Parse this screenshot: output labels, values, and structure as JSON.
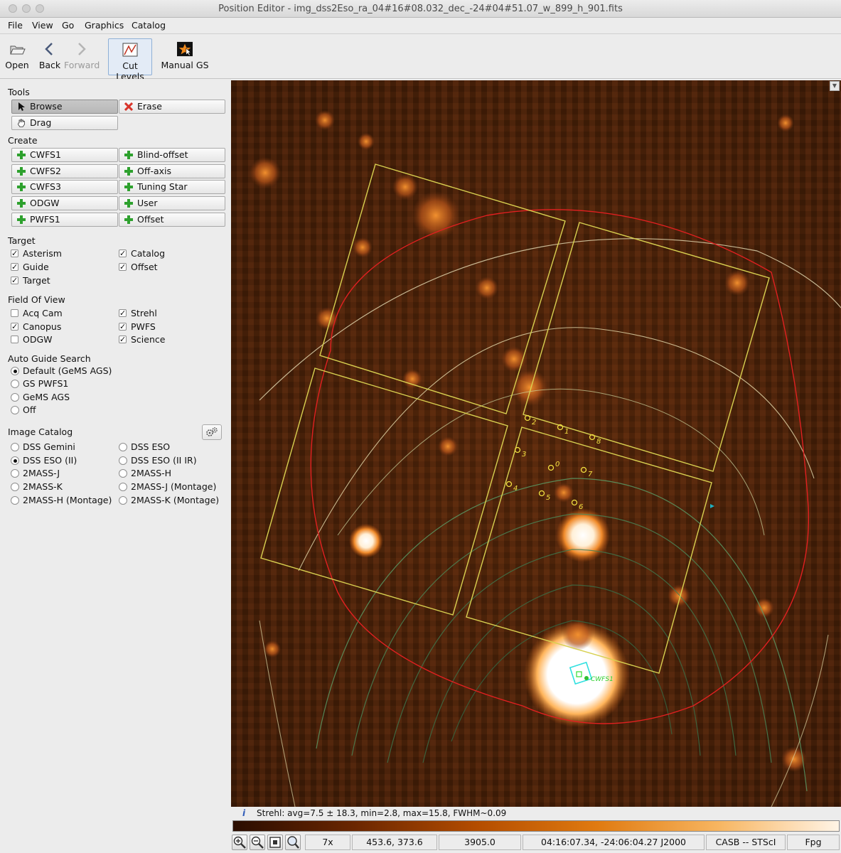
{
  "window": {
    "title": "Position Editor - img_dss2Eso_ra_04#16#08.032_dec_-24#04#51.07_w_899_h_901.fits"
  },
  "menu": [
    "File",
    "View",
    "Go",
    "Graphics",
    "Catalog"
  ],
  "toolbar": {
    "open": "Open",
    "back": "Back",
    "forward": "Forward",
    "cut_levels": "Cut Levels",
    "manual_gs": "Manual GS"
  },
  "tools": {
    "heading": "Tools",
    "browse": "Browse",
    "erase": "Erase",
    "drag": "Drag"
  },
  "create": {
    "heading": "Create",
    "left": [
      "CWFS1",
      "CWFS2",
      "CWFS3",
      "ODGW",
      "PWFS1"
    ],
    "right": [
      "Blind-offset",
      "Off-axis",
      "Tuning Star",
      "User",
      "Offset"
    ]
  },
  "target": {
    "heading": "Target",
    "items": [
      {
        "label": "Asterism",
        "checked": true
      },
      {
        "label": "Catalog",
        "checked": true
      },
      {
        "label": "Guide",
        "checked": true
      },
      {
        "label": "Offset",
        "checked": true
      },
      {
        "label": "Target",
        "checked": true
      }
    ]
  },
  "fov": {
    "heading": "Field Of View",
    "items": [
      {
        "label": "Acq Cam",
        "checked": false
      },
      {
        "label": "Strehl",
        "checked": true
      },
      {
        "label": "Canopus",
        "checked": true
      },
      {
        "label": "PWFS",
        "checked": true
      },
      {
        "label": "ODGW",
        "checked": false
      },
      {
        "label": "Science",
        "checked": true
      }
    ]
  },
  "ags": {
    "heading": "Auto Guide Search",
    "options": [
      "Default (GeMS AGS)",
      "GS PWFS1",
      "GeMS AGS",
      "Off"
    ],
    "selected": 0
  },
  "catalog": {
    "heading": "Image Catalog",
    "options": [
      "DSS Gemini",
      "DSS ESO",
      "DSS ESO (II)",
      "DSS ESO (II IR)",
      "2MASS-J",
      "2MASS-H",
      "2MASS-K",
      "2MASS-J (Montage)",
      "2MASS-H (Montage)",
      "2MASS-K (Montage)"
    ],
    "selected": 2
  },
  "overlay": {
    "star_labels": [
      "0",
      "1",
      "2",
      "3",
      "4",
      "5",
      "6",
      "7",
      "8"
    ],
    "guide_label": "CWFS1"
  },
  "info": {
    "icon": "i",
    "text": "Strehl: avg=7.5 ± 18.3,  min=2.8,  max=15.8,  FWHM~0.09"
  },
  "status": {
    "zoom": "7x",
    "pixel": "453.6, 373.6",
    "value": "3905.0",
    "coords": "04:16:07.34, -24:06:04.27 J2000",
    "source": "CASB -- STScI",
    "format": "Fpg"
  }
}
